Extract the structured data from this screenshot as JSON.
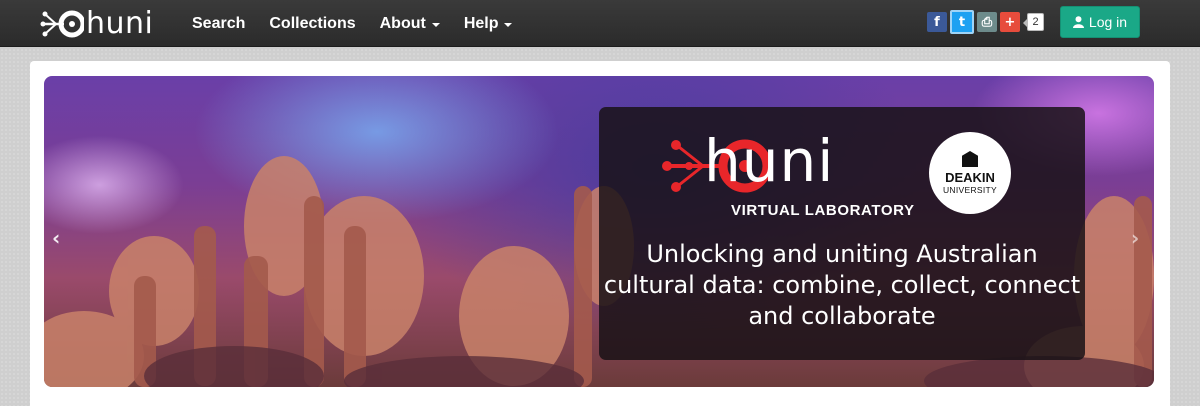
{
  "brand": {
    "name": "huni",
    "icon": "huni-logo-icon"
  },
  "nav": {
    "items": [
      {
        "label": "Search",
        "dropdown": false
      },
      {
        "label": "Collections",
        "dropdown": false
      },
      {
        "label": "About",
        "dropdown": true
      },
      {
        "label": "Help",
        "dropdown": true
      }
    ]
  },
  "share": {
    "facebook": "f",
    "twitter": "t",
    "print": "⎙",
    "more": "+",
    "count": "2"
  },
  "login": {
    "label": "Log in",
    "icon": "user-icon"
  },
  "carousel": {
    "prev": "‹",
    "next": "›",
    "caption": {
      "logo_text": "huni",
      "subtitle": "VIRTUAL LABORATORY",
      "partner_name": "DEAKIN",
      "partner_sub": "UNIVERSITY",
      "text": "Unlocking and uniting Australian cultural data: combine, collect, connect and collaborate"
    }
  },
  "colors": {
    "navbar": "#2f2f2f",
    "login": "#1aa887",
    "accent_red": "#e8262a",
    "facebook": "#3b5998",
    "twitter": "#1da1f2",
    "plus": "#e74c3c"
  }
}
